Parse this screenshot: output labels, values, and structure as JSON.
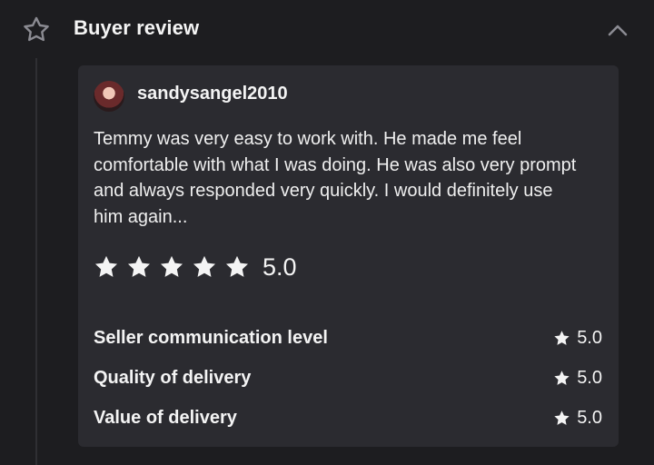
{
  "header": {
    "title": "Buyer review",
    "star_icon": "star-outline-icon",
    "collapse_icon": "chevron-up-icon"
  },
  "review": {
    "username": "sandysangel2010",
    "avatar_icon": "avatar",
    "text": "Temmy was very easy to work with. He made me feel comfortable with what I was doing. He was also very prompt and always responded very quickly. I would definitely use him again...",
    "rating": "5.0",
    "stars_filled": 5,
    "stars_total": 5
  },
  "categories": [
    {
      "label": "Seller communication level",
      "value": "5.0"
    },
    {
      "label": "Quality of delivery",
      "value": "5.0"
    },
    {
      "label": "Value of delivery",
      "value": "5.0"
    }
  ],
  "colors": {
    "background": "#1d1d20",
    "card": "#2b2b30",
    "text": "#f4f4f4",
    "muted_icon": "#8b8b92"
  }
}
